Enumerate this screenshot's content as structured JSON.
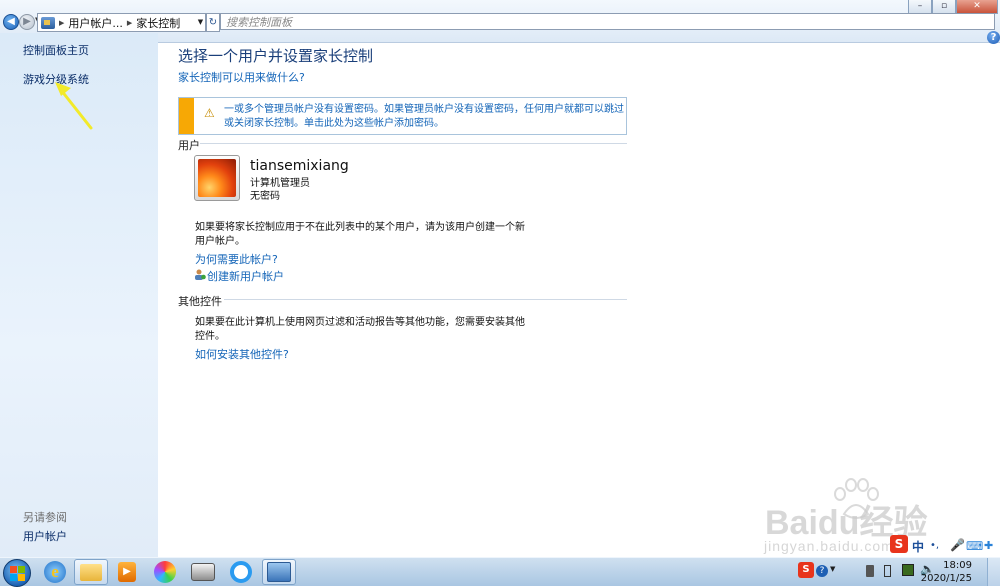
{
  "address_bar": {
    "breadcrumbs": [
      "用户帐户...",
      "家长控制"
    ],
    "search_placeholder": "搜索控制面板"
  },
  "left_pane": {
    "links": [
      "控制面板主页",
      "游戏分级系统"
    ],
    "see_also_heading": "另请参阅",
    "see_also_links": [
      "用户帐户"
    ]
  },
  "main": {
    "title": "选择一个用户并设置家长控制",
    "help_link": "家长控制可以用来做什么?",
    "warning": "一或多个管理员帐户没有设置密码。如果管理员帐户没有设置密码，任何用户就都可以跳过或关闭家长控制。单击此处为这些帐户添加密码。",
    "users_section": "用户",
    "user": {
      "name": "tiansemixiang",
      "role": "计算机管理员",
      "password_status": "无密码"
    },
    "create_note": "如果要将家长控制应用于不在此列表中的某个用户，请为该用户创建一个新用户帐户。",
    "why_link": "为何需要此帐户?",
    "create_link": "创建新用户帐户",
    "other_section": "其他控件",
    "other_note": "如果要在此计算机上使用网页过滤和活动报告等其他功能，您需要安装其他控件。",
    "install_link": "如何安装其他控件?"
  },
  "taskbar": {
    "apps": [
      "internet-explorer-icon",
      "file-explorer-icon",
      "media-player-icon",
      "color-wheel-app-icon",
      "scanner-app-icon",
      "browser-app-icon",
      "control-panel-icon"
    ],
    "time": "18:09",
    "date": "2020/1/25",
    "ime_label": "中"
  },
  "watermark": {
    "text": "Baidu经验",
    "url": "jingyan.baidu.com"
  },
  "colors": {
    "link": "#1465b8",
    "title": "#1a3f7a",
    "warning_bar": "#f7a805",
    "left_pane": "#dbeaf8"
  }
}
